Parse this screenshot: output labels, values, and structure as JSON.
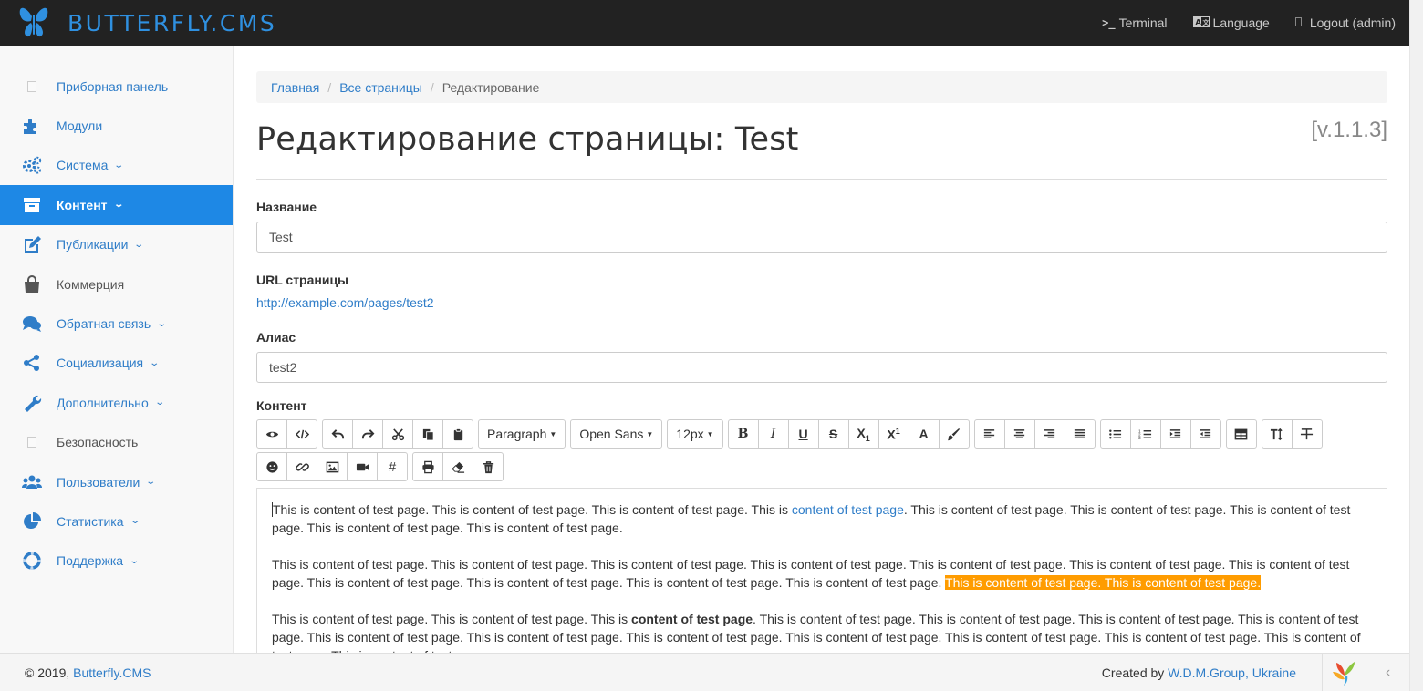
{
  "brand": {
    "name": "BUTTERFLY.CMS"
  },
  "topnav": {
    "terminal": "Terminal",
    "language": "Language",
    "logout": "Logout (admin)"
  },
  "sidebar": {
    "items": [
      {
        "label": "Приборная панель",
        "icon": "square-icon"
      },
      {
        "label": "Модули",
        "icon": "puzzle-icon"
      },
      {
        "label": "Система",
        "icon": "cogs-icon",
        "caret": true
      },
      {
        "label": "Контент",
        "icon": "archive-icon",
        "caret": true,
        "active": true
      },
      {
        "label": "Публикации",
        "icon": "edit-icon",
        "caret": true
      },
      {
        "label": "Коммерция",
        "icon": "shopping-bag-icon"
      },
      {
        "label": "Обратная связь",
        "icon": "comments-icon",
        "caret": true
      },
      {
        "label": "Социализация",
        "icon": "share-icon",
        "caret": true
      },
      {
        "label": "Дополнительно",
        "icon": "wrench-icon",
        "caret": true
      },
      {
        "label": "Безопасность",
        "icon": "square-icon"
      },
      {
        "label": "Пользователи",
        "icon": "users-icon",
        "caret": true
      },
      {
        "label": "Статистика",
        "icon": "pie-chart-icon",
        "caret": true
      },
      {
        "label": "Поддержка",
        "icon": "life-ring-icon",
        "caret": true
      }
    ]
  },
  "breadcrumb": {
    "home": "Главная",
    "pages": "Все страницы",
    "current": "Редактирование"
  },
  "page": {
    "title": "Редактирование страницы: Test",
    "version": "[v.1.1.3]"
  },
  "form": {
    "name_label": "Название",
    "name_value": "Test",
    "url_label": "URL страницы",
    "url_value": "http://example.com/pages/test2",
    "alias_label": "Алиас",
    "alias_value": "test2",
    "content_label": "Контент"
  },
  "toolbar": {
    "paragraph": "Paragraph",
    "font": "Open Sans",
    "size": "12px"
  },
  "editor": {
    "p1_a": "This is content of test page. This is content of test page. This is content of test page. This is ",
    "p1_link": "content of test page",
    "p1_b": ". This is content of test page. This is content of test page. This is content of test page. This is content of test page. This is content of test page.",
    "p2_a": "This is content of test page. This is content of test page. This is content of test page. This is content of test page. This is content of test page. This is content of test page. This is content of test page. This is content of test page. This is content of test page. This is content of test page. This is content of test page. ",
    "p2_hl": "This is content of test page. This is content of test page.",
    "p3_a": "This is content of test page. This is content of test page. This is ",
    "p3_bold": "content of test page",
    "p3_b": ". This is content of test page. This is content of test page. This is content of test page. This is content of test page. This is content of test page. This is content of test page. This is content of test page. This is content of test page. This is content of test page. This is content of test page. This is content of test page. This is content of test page."
  },
  "footer": {
    "copyright": "© 2019, ",
    "brand_link": "Butterfly.CMS",
    "created_by": "Created by ",
    "company": "W.D.M.Group, Ukraine"
  },
  "colors": {
    "accent": "#1e88e5",
    "link": "#2f7dc8",
    "highlight": "#ff9c00",
    "topbar": "#222222"
  }
}
